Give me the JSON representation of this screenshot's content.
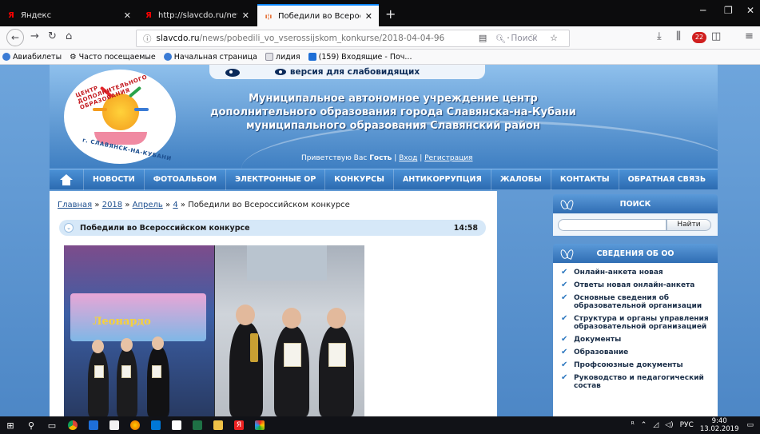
{
  "browser": {
    "tabs": [
      {
        "title": "Яндекс",
        "favicon": "yandex-icon",
        "active": false
      },
      {
        "title": "http://slavcdo.ru/news/pobed",
        "favicon": "yandex-icon",
        "active": false
      },
      {
        "title": "Победили во Всероссийском",
        "favicon": "site-icon",
        "active": true
      }
    ],
    "new_tab": "+",
    "url_host": "slavcdo.ru",
    "url_path": "/news/pobedili_vo_vserossijskom_konkurse/2018-04-04-96",
    "search_placeholder": "Поиск",
    "url_actions": "▤ ··· ♡ ☆",
    "bookmarks": [
      {
        "label": "Авиабилеты",
        "icon": "globe-icon"
      },
      {
        "label": "Часто посещаемые",
        "icon": "gear-icon"
      },
      {
        "label": "Начальная страница",
        "icon": "globe-icon"
      },
      {
        "label": "лидия",
        "icon": "folder-icon"
      },
      {
        "label": "(159) Входящие - Поч...",
        "icon": "mail-icon"
      }
    ],
    "ext_badge": "22"
  },
  "site": {
    "vision_link": "версия для слабовидящих",
    "logo_text_top": "ЦЕНТР ДОПОЛНИТЕЛЬНОГО ОБРАЗОВАНИЯ",
    "logo_text_bottom": "г. СЛАВЯНСК-НА-КУБАНИ",
    "title_lines": [
      "Муниципальное автономное учреждение центр",
      "дополнительного образования города Славянска-на-Кубани",
      "муниципального образования Славянский район"
    ],
    "greet_prefix": "Приветствую Вас",
    "greet_user": "Гость",
    "login": "Вход",
    "register": "Регистрация",
    "menu": [
      "НОВОСТИ",
      "ФОТОАЛЬБОМ",
      "ЭЛЕКТРОННЫЕ ОР",
      "КОНКУРСЫ",
      "АНТИКОРРУПЦИЯ",
      "ЖАЛОБЫ",
      "КОНТАКТЫ",
      "ОБРАТНАЯ СВЯЗЬ"
    ],
    "breadcrumb": {
      "home": "Главная",
      "year": "2018",
      "month": "Апрель",
      "day": "4",
      "current": "Победили во Всероссийском конкурсе",
      "sep": "»"
    },
    "post": {
      "title": "Победили во Всероссийском конкурсе",
      "time": "14:58"
    },
    "photo_banner": "Леонардо"
  },
  "sidebar": {
    "search_title": "ПОИСК",
    "search_button": "Найти",
    "info_title": "СВЕДЕНИЯ ОБ ОО",
    "items": [
      "Онлайн-анкета новая",
      "Ответы новая онлайн-анкета",
      "Основные сведения об образовательной организации",
      "Структура и органы управления образовательной организацией",
      "Документы",
      "Образование",
      "Профсоюзные документы",
      "Руководство и педагогический состав"
    ]
  },
  "taskbar": {
    "lang": "РУС",
    "time": "9:40",
    "date": "13.02.2019"
  },
  "colors": {
    "accent": "#2c6bb1",
    "header_top": "#8fc0ec",
    "tab_accent": "#0a84ff"
  }
}
